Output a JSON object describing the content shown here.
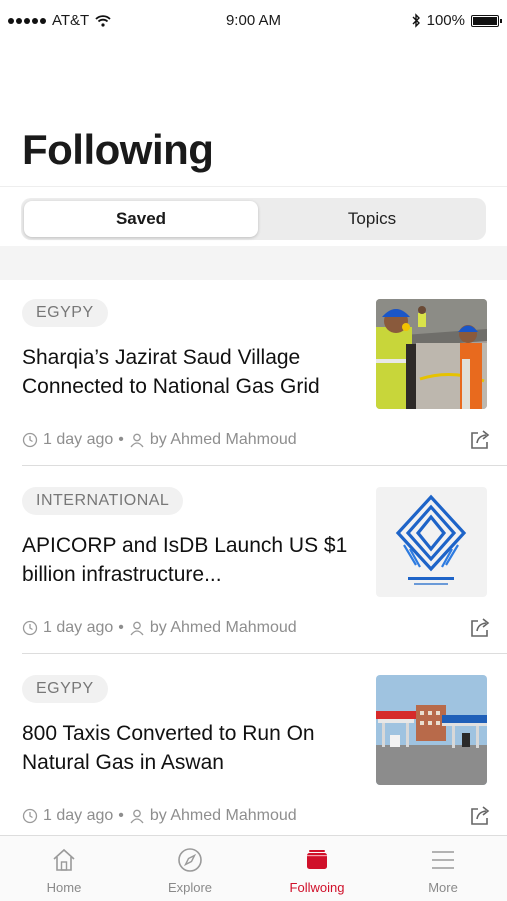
{
  "status_bar": {
    "carrier": "AT&T",
    "time": "9:00 AM",
    "battery": "100%"
  },
  "page": {
    "title": "Following"
  },
  "segments": {
    "saved": "Saved",
    "topics": "Topics",
    "selected": "Saved"
  },
  "articles": [
    {
      "tag": "EGYPY",
      "headline": "Sharqia’s Jazirat Saud Village Connected to National Gas Grid",
      "time": "1 day ago",
      "author": "by Ahmed Mahmoud",
      "image": "workers-in-safety-gear-photo"
    },
    {
      "tag": "INTERNATIONAL",
      "headline": "APICORP and IsDB Launch US $1 billion infrastructure...",
      "time": "1 day ago",
      "author": "by Ahmed Mahmoud",
      "image": "apicorp-logo-image"
    },
    {
      "tag": "EGYPY",
      "headline": "800 Taxis Converted to Run On Natural Gas in Aswan",
      "time": "1 day ago",
      "author": "by Ahmed Mahmoud",
      "image": "gas-station-photo"
    }
  ],
  "meta_separator": "•",
  "tab_bar": {
    "items": [
      {
        "label": "Home",
        "icon": "home-icon"
      },
      {
        "label": "Explore",
        "icon": "compass-icon"
      },
      {
        "label": "Follwoing",
        "icon": "folder-icon"
      },
      {
        "label": "More",
        "icon": "menu-icon"
      }
    ],
    "active": "Follwoing",
    "active_color": "#d0102a"
  }
}
